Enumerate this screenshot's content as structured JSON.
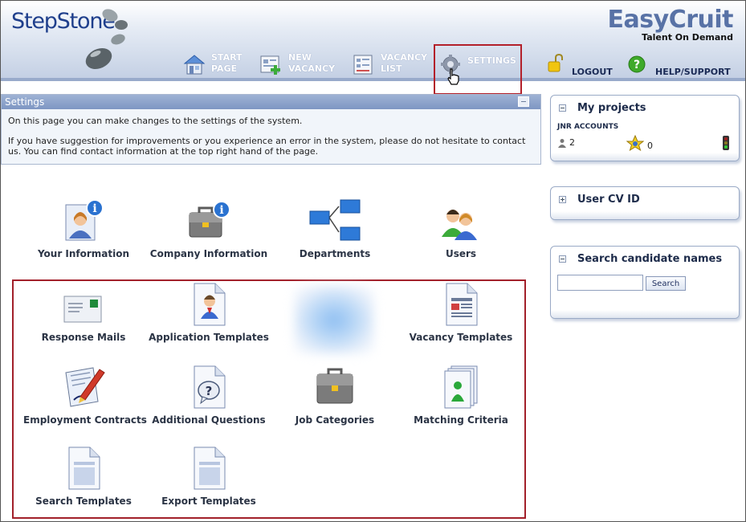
{
  "header": {
    "logo_text": "StepStone",
    "brand_name": "EasyCruit",
    "brand_tag": "Talent On Demand",
    "nav": [
      {
        "line1": "START",
        "line2": "PAGE",
        "icon": "house-icon"
      },
      {
        "line1": "NEW",
        "line2": "VACANCY",
        "icon": "new-vacancy-icon"
      },
      {
        "line1": "VACANCY",
        "line2": "LIST",
        "icon": "vacancy-list-icon"
      },
      {
        "line1": "SETTINGS",
        "line2": "",
        "icon": "gear-icon"
      }
    ],
    "logout_label": "LOGOUT",
    "help_label": "HELP/SUPPORT"
  },
  "settings": {
    "title": "Settings",
    "text1": "On this page you can make changes to the settings of the system.",
    "text2": "If you have suggestion for improvements or you experience an error in the system, please do not hesitate to contact us. You can find contact information at the top right hand of the page."
  },
  "tiles": {
    "your_information": "Your Information",
    "company_information": "Company Information",
    "departments": "Departments",
    "users": "Users",
    "response_mails": "Response Mails",
    "application_templates": "Application Templates",
    "vacancy_templates": "Vacancy Templates",
    "employment_contracts": "Employment Contracts",
    "additional_questions": "Additional Questions",
    "job_categories": "Job Categories",
    "matching_criteria": "Matching Criteria",
    "search_templates": "Search Templates",
    "export_templates": "Export Templates"
  },
  "sidebar": {
    "projects_title": "My projects",
    "projects_account": "JNR ACCOUNTS",
    "projects_people_count": "2",
    "projects_star_count": "0",
    "cv_title": "User CV ID",
    "search_title": "Search candidate names",
    "search_value": "",
    "search_button": "Search"
  },
  "colors": {
    "brand": "#5872a6",
    "logo": "#1f3f8c",
    "highlight": "#b3202a"
  }
}
